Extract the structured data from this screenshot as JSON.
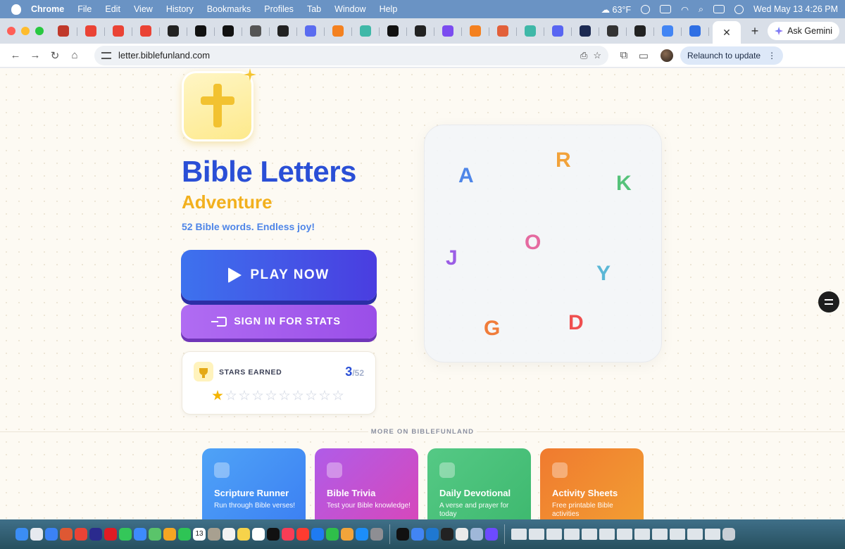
{
  "menubar": {
    "app": "Chrome",
    "items": [
      "File",
      "Edit",
      "View",
      "History",
      "Bookmarks",
      "Profiles",
      "Tab",
      "Window",
      "Help"
    ],
    "weather": "63°F",
    "datetime": "Wed May 13  4:26 PM"
  },
  "tabs": {
    "favicons": [
      {
        "name": "bible-site-icon",
        "color": "#c0392b"
      },
      {
        "name": "gmail-icon",
        "color": "#ea4335"
      },
      {
        "name": "gmail-icon",
        "color": "#ea4335"
      },
      {
        "name": "gmail-icon",
        "color": "#ea4335"
      },
      {
        "name": "app-icon",
        "color": "#222222"
      },
      {
        "name": "triangle-icon",
        "color": "#111111"
      },
      {
        "name": "triangle-icon",
        "color": "#111111"
      },
      {
        "name": "globe-icon",
        "color": "#555555"
      },
      {
        "name": "app-icon",
        "color": "#222222"
      },
      {
        "name": "claude-icon",
        "color": "#5a6cf0"
      },
      {
        "name": "cloud-icon",
        "color": "#f48120"
      },
      {
        "name": "bolt-icon",
        "color": "#3fb8a8"
      },
      {
        "name": "github-icon",
        "color": "#111111"
      },
      {
        "name": "app-icon",
        "color": "#222222"
      },
      {
        "name": "chat-icon",
        "color": "#7b4cf0"
      },
      {
        "name": "cloud-icon",
        "color": "#f48120"
      },
      {
        "name": "spark-icon",
        "color": "#e2603a"
      },
      {
        "name": "bolt-icon",
        "color": "#3fb8a8"
      },
      {
        "name": "discord-icon",
        "color": "#5865f2"
      },
      {
        "name": "app-icon",
        "color": "#1c2a52"
      },
      {
        "name": "openai-icon",
        "color": "#333333"
      },
      {
        "name": "app-icon",
        "color": "#222222"
      },
      {
        "name": "google-icon",
        "color": "#4285f4"
      },
      {
        "name": "plus-circle-icon",
        "color": "#2f6fe4"
      }
    ],
    "active_close": "✕",
    "new_tab": "+",
    "gemini_label": "Ask Gemini"
  },
  "toolbar": {
    "url": "letter.biblefunland.com",
    "relaunch_label": "Relaunch to update"
  },
  "hero": {
    "title": "Bible Letters",
    "subtitle": "Adventure",
    "tagline": "52 Bible words. Endless joy!",
    "play_label": "PLAY NOW",
    "signin_label": "SIGN IN FOR STATS"
  },
  "stars": {
    "label": "STARS EARNED",
    "earned": "3",
    "total": "/52",
    "shown_filled": 1,
    "shown_total": 10
  },
  "floating_letters": [
    {
      "char": "A",
      "color": "#4f86e8"
    },
    {
      "char": "R",
      "color": "#f2a23a"
    },
    {
      "char": "K",
      "color": "#55c27a"
    },
    {
      "char": "O",
      "color": "#e56aa0"
    },
    {
      "char": "J",
      "color": "#9b5de5"
    },
    {
      "char": "Y",
      "color": "#5bb7d6"
    },
    {
      "char": "G",
      "color": "#f07c3a"
    },
    {
      "char": "D",
      "color": "#ef4f4f"
    }
  ],
  "more": {
    "label": "MORE ON BIBLEFUNLAND",
    "cards": [
      {
        "title": "Scripture Runner",
        "desc": "Run through Bible verses!",
        "icon": "runner-icon"
      },
      {
        "title": "Bible Trivia",
        "desc": "Test your Bible knowledge!",
        "icon": "target-icon"
      },
      {
        "title": "Daily Devotional",
        "desc": "A verse and prayer for today",
        "icon": "praying-hands-icon"
      },
      {
        "title": "Activity Sheets",
        "desc": "Free printable Bible activities",
        "icon": "printer-icon"
      }
    ]
  },
  "colors": {
    "title_blue": "#2a4fd6",
    "subtitle_gold": "#f2b01e",
    "play_gradient": [
      "#3d72ee",
      "#4a3de0"
    ],
    "signin_gradient": [
      "#b06cf2",
      "#9a4ee8"
    ],
    "card_gradients": [
      [
        "#4fa3f7",
        "#3b7ef2"
      ],
      [
        "#b05ce8",
        "#d946b8"
      ],
      [
        "#55c985",
        "#3db86e"
      ],
      [
        "#f07a2f",
        "#f2a033"
      ]
    ]
  },
  "dock": {
    "calendar_day": "13",
    "apps": [
      "finder-icon",
      "launchpad-icon",
      "safari-icon",
      "duckduckgo-icon",
      "chrome-icon",
      "arc-icon",
      "opera-icon",
      "messages-icon",
      "mail-icon",
      "maps-icon",
      "photos-icon",
      "facetime-icon",
      "calendar-icon",
      "contacts-icon",
      "reminders-icon",
      "notes-icon",
      "freeform-icon",
      "tv-icon",
      "music-icon",
      "news-icon",
      "keynote-icon",
      "numbers-icon",
      "pages-icon",
      "appstore-icon",
      "settings-icon",
      "chatgpt-icon",
      "chrome-icon",
      "vscode-icon",
      "cursor-icon",
      "textedit-icon",
      "preview-icon",
      "proton-icon"
    ]
  }
}
